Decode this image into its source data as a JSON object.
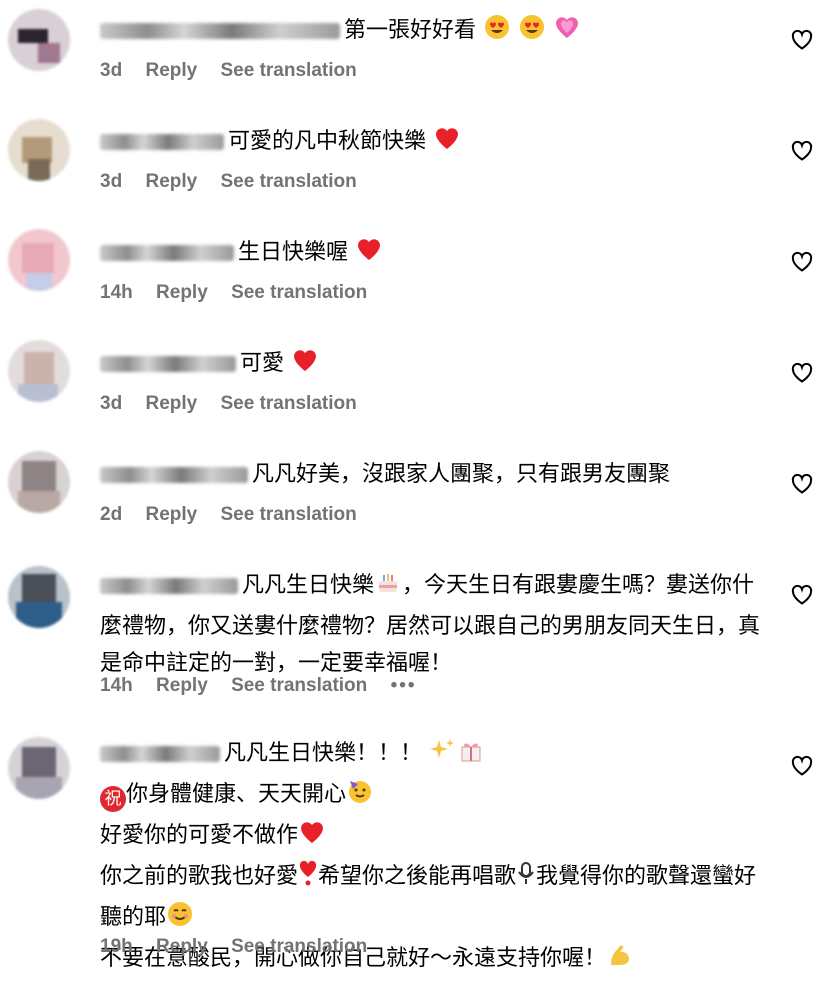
{
  "meta": {
    "reply_label": "Reply",
    "see_translation_label": "See translation",
    "more_label": "•••"
  },
  "comments": [
    {
      "text": "第一張好好看",
      "time": "3d"
    },
    {
      "text": "可愛的凡中秋節快樂",
      "time": "3d"
    },
    {
      "text": "生日快樂喔",
      "time": "14h"
    },
    {
      "text": "可愛",
      "time": "3d"
    },
    {
      "text": "凡凡好美，沒跟家人團聚，只有跟男友團聚",
      "time": "2d"
    },
    {
      "text_parts": [
        "凡凡生日快樂",
        "，今天生日有跟婁慶生嗎？婁送你什麼禮物，你又送婁什麼禮物？居然可以跟自己的男朋友同天生日，真是命中註定的一對，一定要幸福喔！"
      ],
      "time": "14h"
    },
    {
      "lines": [
        "凡凡生日快樂！！！",
        "你身體健康、天天開心",
        "好愛你的可愛不做作",
        "你之前的歌我也好愛",
        "希望你之後能再唱歌",
        "我覺得你的歌聲還蠻好聽的耶",
        "不要在意酸民，開心做你自己就好～永遠支持你喔！"
      ],
      "badge": "祝",
      "time": "19h"
    }
  ],
  "icons": {
    "heart_outline": "heart-outline-icon",
    "heart_eyes": "smiling-face-with-heart-eyes-emoji",
    "pink_heart": "growing-heart-emoji",
    "red_heart": "red-heart-emoji",
    "cake": "birthday-cake-emoji",
    "sparkles": "sparkles-emoji",
    "gift": "wrapped-gift-emoji",
    "party_face": "partying-face-emoji",
    "exclamation_heart": "heart-exclamation-emoji",
    "microphone": "microphone-emoji",
    "smiling_face": "smiling-face-emoji",
    "flexed_biceps": "flexed-biceps-emoji"
  },
  "colors": {
    "meta_gray": "#737373",
    "heart_red": "#e8202a",
    "text": "#000000"
  }
}
